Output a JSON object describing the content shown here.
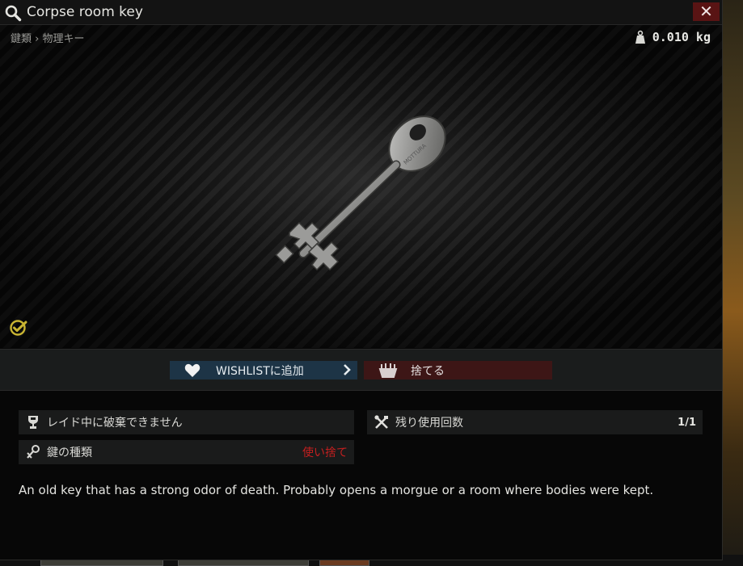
{
  "window": {
    "title": "Corpse room key",
    "close_label": "✕",
    "breadcrumb": [
      "鍵類",
      "物理キー"
    ],
    "breadcrumb_separator": "›",
    "weight": "0.010 kg"
  },
  "actions": {
    "wishlist_label": "WISHLISTに追加",
    "discard_label": "捨てる"
  },
  "stats": {
    "no_discard": "レイド中に破棄できません",
    "uses_label": "残り使用回数",
    "uses_value": "1/1",
    "key_type_label": "鍵の種類",
    "key_type_value": "使い捨て"
  },
  "description": "An old key that has a strong odor of death. Probably opens a morgue or a room where bodies were kept.",
  "icons": {
    "title": "magnifier-icon",
    "weight": "weight-icon",
    "examined": "checkmark-circle-icon",
    "wishlist": "heart-icon",
    "discard": "discard-icon",
    "no_discard": "trophy-icon",
    "uses": "tools-icon",
    "key_type": "key-icon"
  },
  "colors": {
    "wishlist_bg": "#1d3446",
    "discard_bg": "#3d1616",
    "close_bg": "#591414",
    "warning_text": "#c41f1f",
    "check_icon": "#c8b432"
  }
}
